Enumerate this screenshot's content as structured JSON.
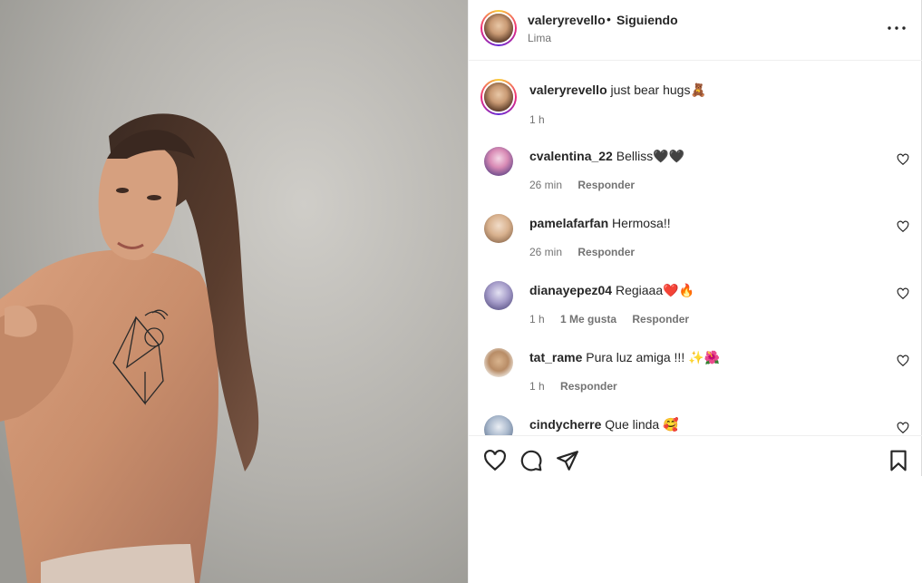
{
  "post": {
    "username": "valeryrevello",
    "separator": "•",
    "follow_status": "Siguiendo",
    "location": "Lima"
  },
  "caption": {
    "username": "valeryrevello",
    "text": "just bear hugs🧸",
    "time": "1 h"
  },
  "comments": [
    {
      "username": "cvalentina_22",
      "text": "Belliss🖤🖤",
      "time": "26 min",
      "likes": "",
      "reply": "Responder"
    },
    {
      "username": "pamelafarfan",
      "text": "Hermosa!!",
      "time": "26 min",
      "likes": "",
      "reply": "Responder"
    },
    {
      "username": "dianayepez04",
      "text": "Regiaaa❤️🔥",
      "time": "1 h",
      "likes": "1 Me gusta",
      "reply": "Responder"
    },
    {
      "username": "tat_rame",
      "text": "Pura luz amiga !!! ✨🌺",
      "time": "1 h",
      "likes": "",
      "reply": "Responder"
    },
    {
      "username": "cindycherre",
      "text": "Que linda 🥰",
      "time": "",
      "likes": "",
      "reply": ""
    }
  ],
  "icons": {
    "more": "more-options-icon",
    "like": "heart-icon",
    "comment": "comment-icon",
    "share": "paper-plane-icon",
    "save": "bookmark-icon"
  }
}
